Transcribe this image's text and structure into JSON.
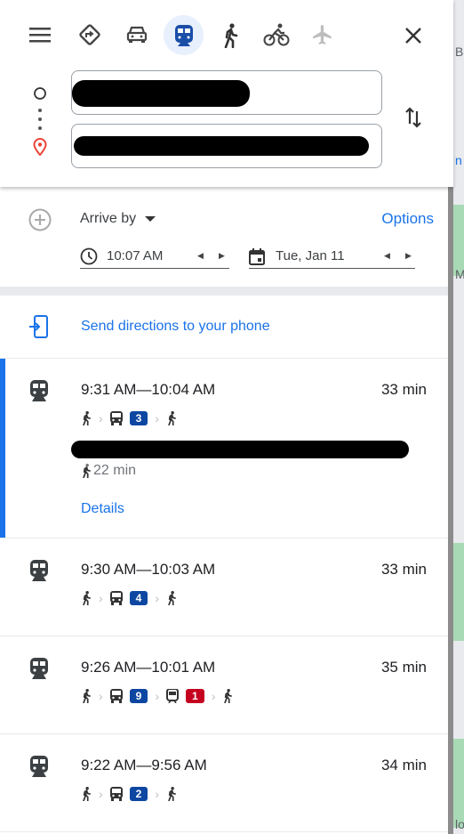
{
  "travel_modes": [
    {
      "name": "best"
    },
    {
      "name": "driving"
    },
    {
      "name": "transit",
      "selected": true
    },
    {
      "name": "walking"
    },
    {
      "name": "cycling"
    },
    {
      "name": "flights"
    }
  ],
  "map_labels": [
    "Bo",
    "n",
    "M",
    "lo"
  ],
  "options": {
    "arrive_by": "Arrive by",
    "options_link": "Options",
    "time": "10:07 AM",
    "date": "Tue, Jan 11"
  },
  "send_to_phone": "Send directions to your phone",
  "colors": {
    "accent": "#1a73e8",
    "line_blue": "#0d47a1",
    "line_red": "#c5001f"
  },
  "routes": [
    {
      "times": "9:31 AM—10:04 AM",
      "duration": "33 min",
      "lines": [
        {
          "label": "3",
          "color": "#0d47a1",
          "icon": "bus"
        }
      ],
      "walk": "22 min",
      "details": "Details",
      "selected": true
    },
    {
      "times": "9:30 AM—10:03 AM",
      "duration": "33 min",
      "lines": [
        {
          "label": "4",
          "color": "#0d47a1",
          "icon": "bus"
        }
      ]
    },
    {
      "times": "9:26 AM—10:01 AM",
      "duration": "35 min",
      "lines": [
        {
          "label": "9",
          "color": "#0d47a1",
          "icon": "bus"
        },
        {
          "label": "1",
          "color": "#c5001f",
          "icon": "train"
        }
      ]
    },
    {
      "times": "9:22 AM—9:56 AM",
      "duration": "34 min",
      "lines": [
        {
          "label": "2",
          "color": "#0d47a1",
          "icon": "bus"
        }
      ]
    }
  ]
}
